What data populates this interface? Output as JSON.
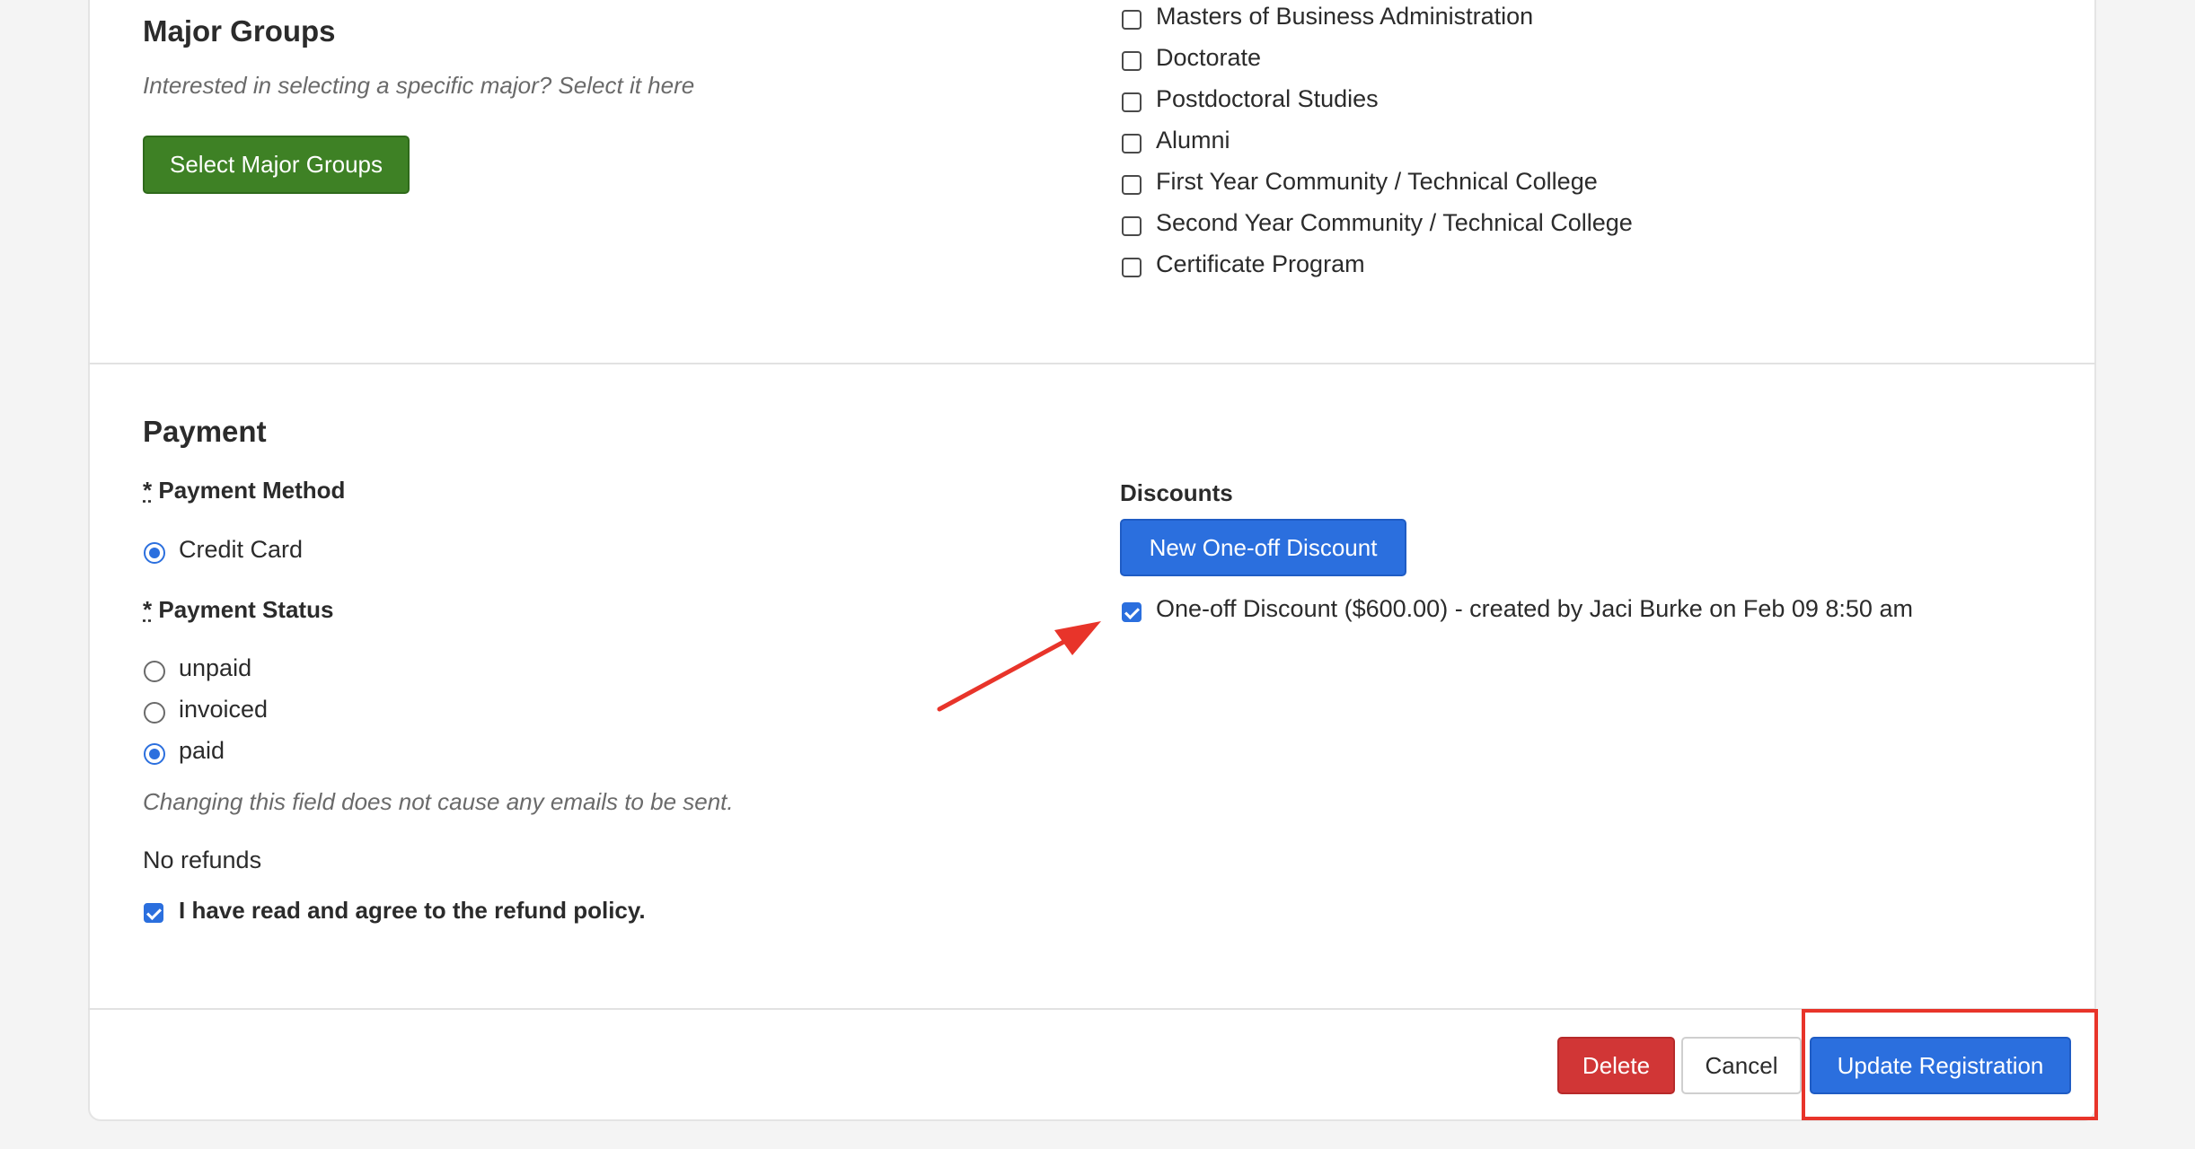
{
  "major_groups": {
    "title": "Major Groups",
    "help": "Interested in selecting a specific major? Select it here",
    "button_label": "Select Major Groups"
  },
  "class_levels": [
    {
      "label": "Masters of Business Administration",
      "checked": false
    },
    {
      "label": "Doctorate",
      "checked": false
    },
    {
      "label": "Postdoctoral Studies",
      "checked": false
    },
    {
      "label": "Alumni",
      "checked": false
    },
    {
      "label": "First Year Community / Technical College",
      "checked": false
    },
    {
      "label": "Second Year Community / Technical College",
      "checked": false
    },
    {
      "label": "Certificate Program",
      "checked": false
    }
  ],
  "payment": {
    "title": "Payment",
    "required_marker": "*",
    "method_label": "Payment Method",
    "method_options": [
      {
        "label": "Credit Card",
        "selected": true
      }
    ],
    "status_label": "Payment Status",
    "status_options": [
      {
        "label": "unpaid",
        "selected": false
      },
      {
        "label": "invoiced",
        "selected": false
      },
      {
        "label": "paid",
        "selected": true
      }
    ],
    "status_help": "Changing this field does not cause any emails to be sent.",
    "refund_text": "No refunds",
    "refund_agree_label": "I have read and agree to the refund policy.",
    "refund_agree_checked": true
  },
  "discounts": {
    "title": "Discounts",
    "new_button_label": "New One-off Discount",
    "items": [
      {
        "label": "One-off Discount ($600.00) - created by Jaci Burke on Feb 09 8:50 am",
        "checked": true
      }
    ]
  },
  "footer": {
    "delete_label": "Delete",
    "cancel_label": "Cancel",
    "update_label": "Update Registration"
  },
  "colors": {
    "green_button": "#3e8125",
    "blue_button": "#2b6fde",
    "red_button": "#d13636",
    "annotation_red": "#e8342a"
  }
}
